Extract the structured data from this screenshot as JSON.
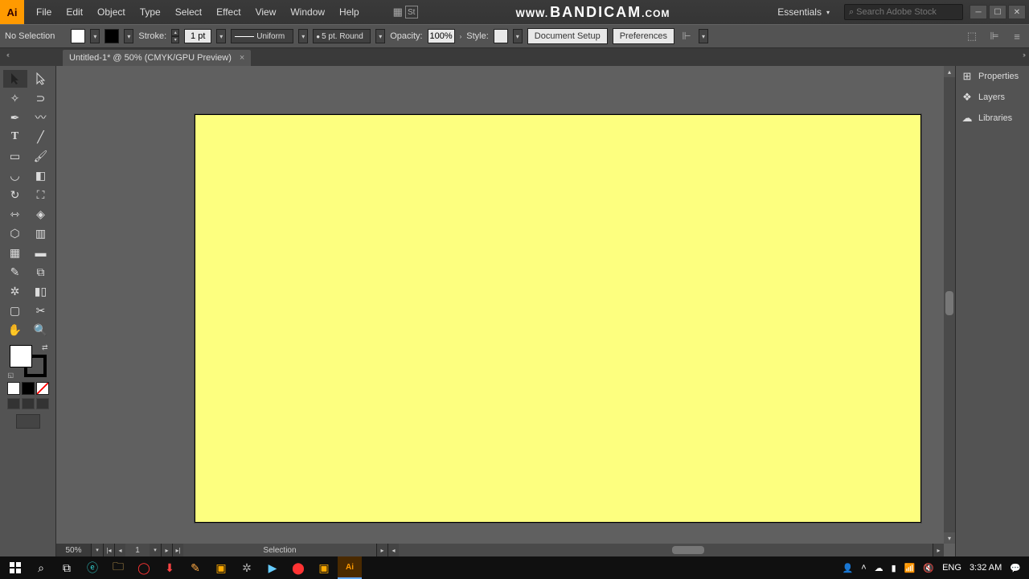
{
  "menu": {
    "items": [
      "File",
      "Edit",
      "Object",
      "Type",
      "Select",
      "Effect",
      "View",
      "Window",
      "Help"
    ]
  },
  "watermark": {
    "prefix": "WWW.",
    "main": "BANDICAM",
    "suffix": ".COM"
  },
  "workspace": "Essentials",
  "search_placeholder": "Search Adobe Stock",
  "controlbar": {
    "selection": "No Selection",
    "stroke_label": "Stroke:",
    "stroke_val": "1 pt",
    "profile": "Uniform",
    "brush": "5 pt. Round",
    "opacity_label": "Opacity:",
    "opacity_val": "100%",
    "style_label": "Style:",
    "docsetup": "Document Setup",
    "prefs": "Preferences"
  },
  "tab": {
    "title": "Untitled-1* @ 50% (CMYK/GPU Preview)"
  },
  "zoom": "50%",
  "artboard_num": "1",
  "current_tool": "Selection",
  "panels": [
    "Properties",
    "Layers",
    "Libraries"
  ],
  "system": {
    "lang": "ENG",
    "time": "3:32 AM"
  }
}
